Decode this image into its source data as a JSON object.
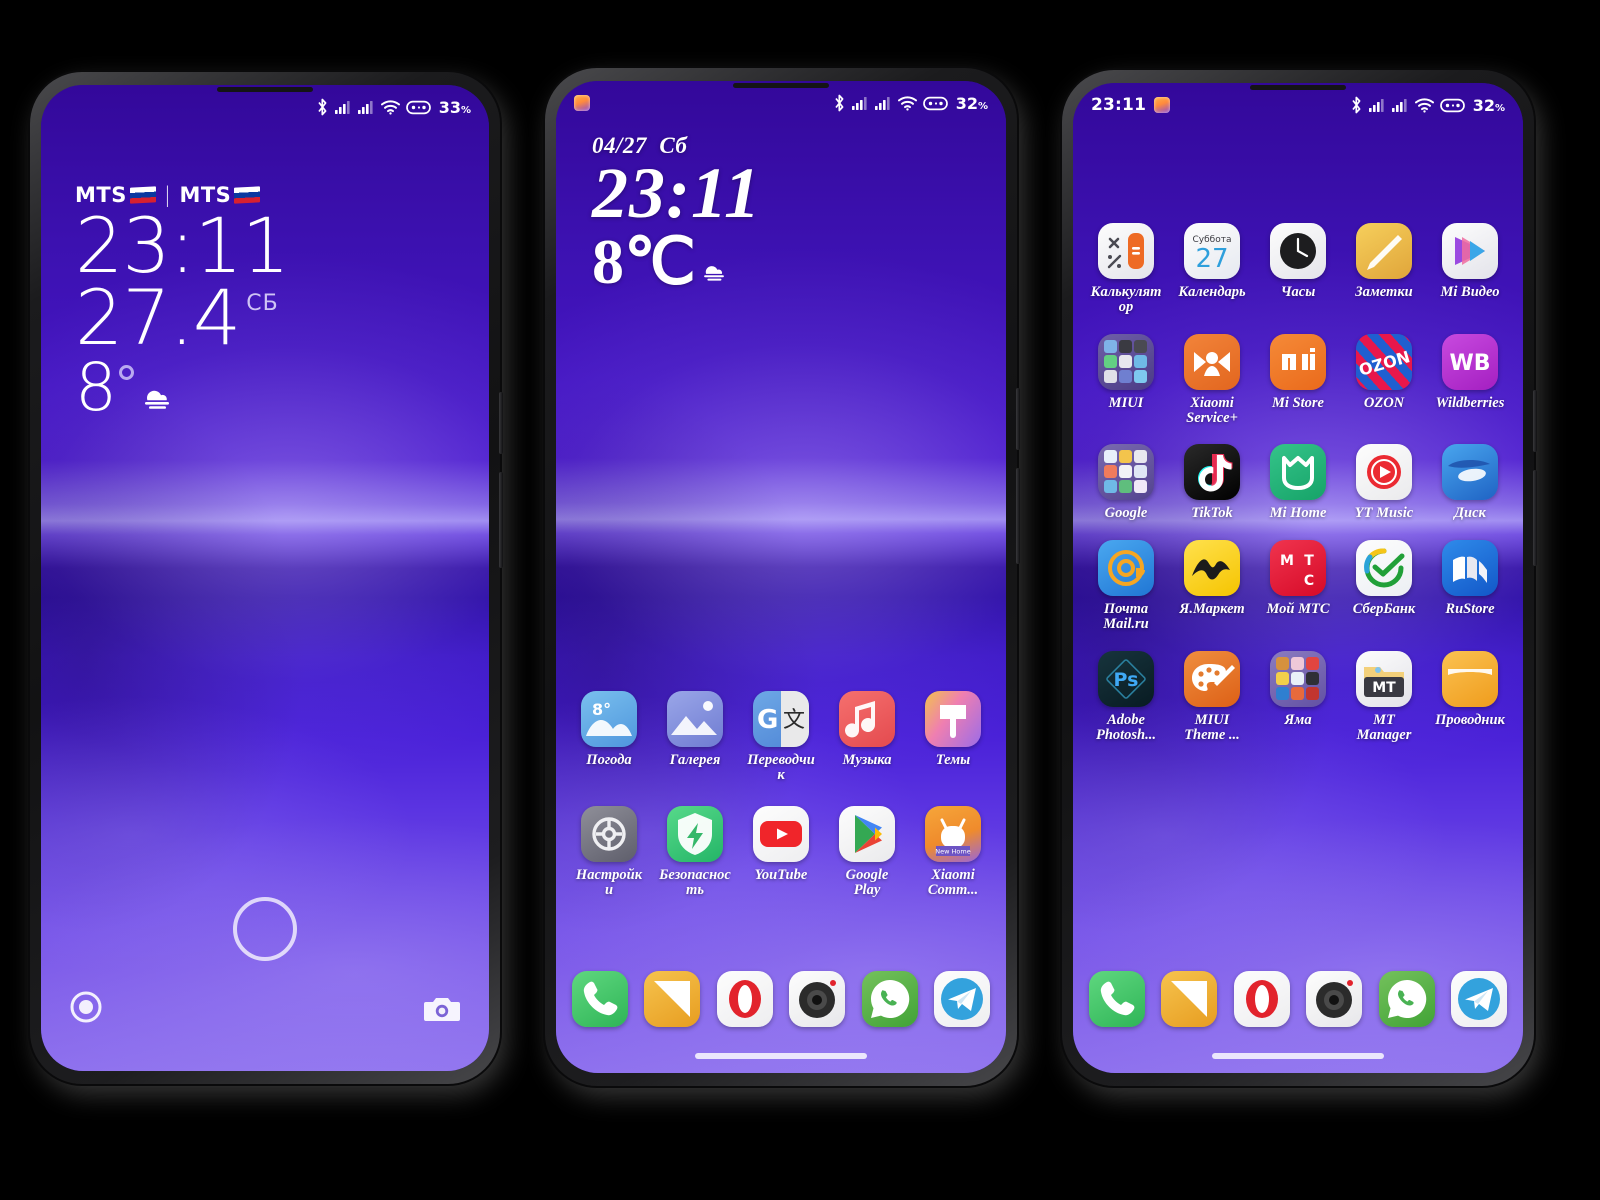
{
  "meta": {
    "screens": 3,
    "wallpaper_desc": "purple gradient sky with light horizon band"
  },
  "phone1": {
    "type": "lockscreen",
    "statusbar": {
      "bluetooth": "bluetooth-icon",
      "signal1": "signal-bars-icon",
      "signal2": "signal-bars-icon",
      "wifi": "wifi-icon",
      "battery": "battery-icon",
      "battery_pct": "33",
      "pct_sign": "%"
    },
    "widget": {
      "carrier1": "MTS",
      "carrier_sep": "|",
      "carrier2": "MTS",
      "time": "23:11",
      "date": "27.4",
      "weekday": "СБ",
      "temp": "8",
      "weather_icon": "fog-icon"
    },
    "bottom": {
      "left_shortcut": "record-circle-icon",
      "unlock": "unlock-circle-icon",
      "right_shortcut": "camera-icon"
    }
  },
  "phone2": {
    "type": "homescreen-page-1",
    "statusbar": {
      "notification": "app-notification-icon",
      "bluetooth": "bluetooth-icon",
      "signal1": "signal-bars-icon",
      "signal2": "signal-bars-icon",
      "wifi": "wifi-icon",
      "battery": "battery-icon",
      "battery_pct": "32",
      "pct_sign": "%"
    },
    "clock_widget": {
      "date": "04/27",
      "weekday": "Сб",
      "time": "23:11",
      "temp": "8℃",
      "weather_icon": "fog-icon"
    },
    "apps": [
      {
        "label": "Погода",
        "icon": "weather-icon",
        "cls": "ic-weather"
      },
      {
        "label": "Галерея",
        "icon": "gallery-icon",
        "cls": "ic-gallery"
      },
      {
        "label": "Переводчик",
        "icon": "google-translate-icon",
        "cls": "ic-translate"
      },
      {
        "label": "Музыка",
        "icon": "music-icon",
        "cls": "ic-music"
      },
      {
        "label": "Темы",
        "icon": "themes-icon",
        "cls": "ic-themes"
      },
      {
        "label": "Настройки",
        "icon": "settings-gear-icon",
        "cls": "ic-settings"
      },
      {
        "label": "Безопасность",
        "icon": "security-shield-icon",
        "cls": "ic-security"
      },
      {
        "label": "YouTube",
        "icon": "youtube-icon",
        "cls": "ic-youtube"
      },
      {
        "label": "Google Play",
        "icon": "google-play-icon",
        "cls": "ic-gplay"
      },
      {
        "label": "Xiaomi Comm...",
        "icon": "xiaomi-community-icon",
        "cls": "ic-xcomm"
      }
    ],
    "dock": [
      {
        "label": "Телефон",
        "icon": "phone-icon",
        "cls": "ic-phone"
      },
      {
        "label": "Сообщения",
        "icon": "messages-icon",
        "cls": "ic-msg"
      },
      {
        "label": "Opera",
        "icon": "opera-icon",
        "cls": "ic-opera"
      },
      {
        "label": "Камера",
        "icon": "camera-icon",
        "cls": "ic-camera"
      },
      {
        "label": "WhatsApp",
        "icon": "whatsapp-icon",
        "cls": "ic-whatsapp"
      },
      {
        "label": "Telegram",
        "icon": "telegram-icon",
        "cls": "ic-telegram"
      }
    ]
  },
  "phone3": {
    "type": "homescreen-page-2",
    "statusbar": {
      "time": "23:11",
      "notification": "app-notification-icon",
      "bluetooth": "bluetooth-icon",
      "signal1": "signal-bars-icon",
      "signal2": "signal-bars-icon",
      "wifi": "wifi-icon",
      "battery": "battery-icon",
      "battery_pct": "32",
      "pct_sign": "%"
    },
    "apps": [
      {
        "label": "Калькулятор",
        "icon": "calculator-icon",
        "cls": "ic-calc"
      },
      {
        "label": "Календарь",
        "icon": "calendar-icon",
        "cls": "ic-cal",
        "cal_weekday": "Суббота",
        "cal_day": "27"
      },
      {
        "label": "Часы",
        "icon": "clock-icon",
        "cls": "ic-clock"
      },
      {
        "label": "Заметки",
        "icon": "notes-pencil-icon",
        "cls": "ic-notes"
      },
      {
        "label": "Mi Видео",
        "icon": "mi-video-icon",
        "cls": "ic-mivideo"
      },
      {
        "label": "MIUI",
        "icon": "miui-folder-icon",
        "cls": "ic-folder"
      },
      {
        "label": "Xiaomi Service+",
        "icon": "xiaomi-service-icon",
        "cls": "ic-xservice"
      },
      {
        "label": "Mi Store",
        "icon": "mi-store-icon",
        "cls": "ic-mistore",
        "glyph": "mi"
      },
      {
        "label": "OZON",
        "icon": "ozon-icon",
        "cls": "ic-ozon",
        "glyph": "OZON"
      },
      {
        "label": "Wildberries",
        "icon": "wildberries-icon",
        "cls": "ic-wb",
        "glyph": "WB"
      },
      {
        "label": "Google",
        "icon": "google-folder-icon",
        "cls": "ic-gfolder"
      },
      {
        "label": "TikTok",
        "icon": "tiktok-icon",
        "cls": "ic-tiktok"
      },
      {
        "label": "Mi Home",
        "icon": "mi-home-icon",
        "cls": "ic-mihome"
      },
      {
        "label": "YT Music",
        "icon": "youtube-music-icon",
        "cls": "ic-ytmusic"
      },
      {
        "label": "Диск",
        "icon": "yandex-disk-icon",
        "cls": "ic-disk"
      },
      {
        "label": "Почта Mail.ru",
        "icon": "mail-ru-icon",
        "cls": "ic-mailru"
      },
      {
        "label": "Я.Маркет",
        "icon": "yandex-market-icon",
        "cls": "ic-yamarket"
      },
      {
        "label": "Мой МТС",
        "icon": "mts-icon",
        "cls": "ic-mts",
        "glyph": "МТС"
      },
      {
        "label": "СберБанк",
        "icon": "sberbank-icon",
        "cls": "ic-sber"
      },
      {
        "label": "RuStore",
        "icon": "rustore-icon",
        "cls": "ic-rustore"
      },
      {
        "label": "Adobe Photosh...",
        "icon": "photoshop-icon",
        "cls": "ic-ps",
        "glyph": "Ps"
      },
      {
        "label": "MIUI Theme ...",
        "icon": "miui-theme-editor-icon",
        "cls": "ic-miuitheme"
      },
      {
        "label": "Яма",
        "icon": "yama-folder-icon",
        "cls": "ic-yama"
      },
      {
        "label": "MT Manager",
        "icon": "mt-manager-icon",
        "cls": "ic-mt",
        "glyph": "MT"
      },
      {
        "label": "Проводник",
        "icon": "file-explorer-icon",
        "cls": "ic-explorer"
      }
    ],
    "dock": [
      {
        "label": "Телефон",
        "icon": "phone-icon",
        "cls": "ic-phone"
      },
      {
        "label": "Сообщения",
        "icon": "messages-icon",
        "cls": "ic-msg"
      },
      {
        "label": "Opera",
        "icon": "opera-icon",
        "cls": "ic-opera"
      },
      {
        "label": "Камера",
        "icon": "camera-icon",
        "cls": "ic-camera"
      },
      {
        "label": "WhatsApp",
        "icon": "whatsapp-icon",
        "cls": "ic-whatsapp"
      },
      {
        "label": "Telegram",
        "icon": "telegram-icon",
        "cls": "ic-telegram"
      }
    ]
  },
  "colors": {
    "wallpaper_top": "#33089a",
    "wallpaper_bottom": "#8f72ee",
    "horizon": "#9e8bef",
    "frame": "#1b1b1d",
    "page_bg": "#000000"
  }
}
